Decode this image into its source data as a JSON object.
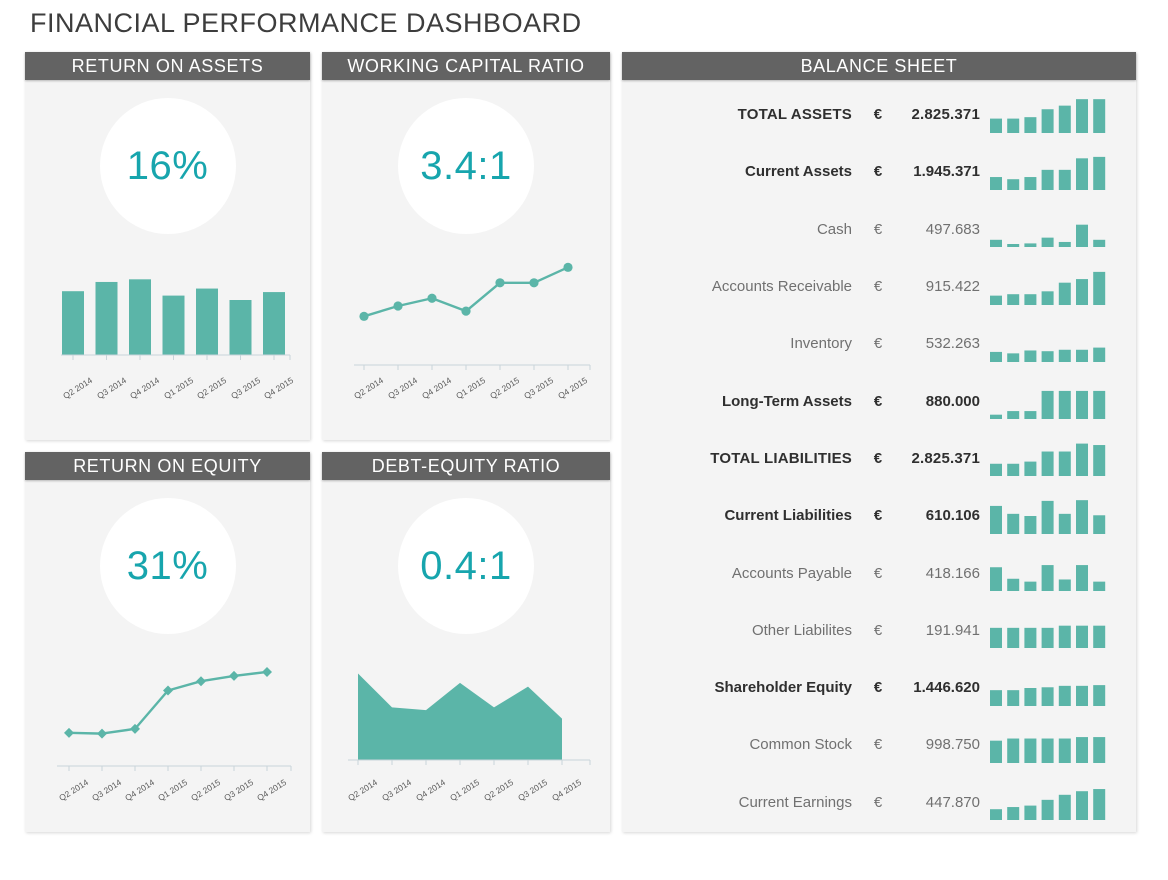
{
  "title": "FINANCIAL PERFORMANCE DASHBOARD",
  "colors": {
    "teal": "#5bb5a8",
    "kpi_text": "#17a5ad",
    "header_gray": "#636363",
    "panel_bg": "#f4f4f4",
    "title_text": "#3d3d3d"
  },
  "panels": {
    "roa": {
      "title": "RETURN ON ASSETS",
      "kpi": "16%"
    },
    "wcr": {
      "title": "WORKING CAPITAL RATIO",
      "kpi": "3.4:1"
    },
    "roe": {
      "title": "RETURN ON EQUITY",
      "kpi": "31%"
    },
    "der": {
      "title": "DEBT-EQUITY RATIO",
      "kpi": "0.4:1"
    },
    "balance": {
      "title": "BALANCE SHEET"
    }
  },
  "chart_data": [
    {
      "id": "roa",
      "type": "bar",
      "title": "RETURN ON ASSETS",
      "categories": [
        "Q2 2014",
        "Q3 2014",
        "Q4 2014",
        "Q1 2015",
        "Q2 2015",
        "Q3 2015",
        "Q4 2015"
      ],
      "values": [
        14.5,
        16.6,
        17.2,
        13.5,
        15.1,
        12.5,
        14.3
      ],
      "ylabel": "",
      "xlabel": "",
      "ylim": [
        0,
        20
      ],
      "grid": false,
      "legend": false
    },
    {
      "id": "wcr",
      "type": "line",
      "title": "WORKING CAPITAL RATIO",
      "categories": [
        "Q2 2014",
        "Q3 2014",
        "Q4 2014",
        "Q1 2015",
        "Q2 2015",
        "Q3 2015",
        "Q4 2015"
      ],
      "values": [
        1.5,
        1.9,
        2.2,
        1.7,
        2.8,
        2.8,
        3.4
      ],
      "marker": "circle",
      "ylabel": "",
      "xlabel": "",
      "ylim": [
        0,
        3.8
      ],
      "grid": false,
      "legend": false
    },
    {
      "id": "roe",
      "type": "line",
      "title": "RETURN ON EQUITY",
      "categories": [
        "Q2 2014",
        "Q3 2014",
        "Q4 2014",
        "Q1 2015",
        "Q2 2015",
        "Q3 2015",
        "Q4 2015"
      ],
      "values": [
        8,
        7.7,
        9.5,
        24,
        27.5,
        29.5,
        31
      ],
      "marker": "diamond",
      "ylabel": "",
      "xlabel": "",
      "ylim": [
        0,
        34
      ],
      "grid": false,
      "legend": false
    },
    {
      "id": "der",
      "type": "area",
      "title": "DEBT-EQUITY RATIO",
      "categories": [
        "Q2 2014",
        "Q3 2014",
        "Q4 2014",
        "Q1 2015",
        "Q2 2015",
        "Q3 2015",
        "Q4 2015"
      ],
      "values": [
        0.92,
        0.56,
        0.53,
        0.82,
        0.56,
        0.78,
        0.44
      ],
      "ylabel": "",
      "xlabel": "",
      "ylim": [
        0,
        1.0
      ],
      "grid": false,
      "legend": false
    }
  ],
  "balance_sheet": {
    "currency": "€",
    "sparkline_periods": [
      "Q2 2014",
      "Q3 2014",
      "Q4 2014",
      "Q1 2015",
      "Q2 2015",
      "Q3 2015",
      "Q4 2015"
    ],
    "rows": [
      {
        "label": "TOTAL ASSETS",
        "level": 0,
        "currency": "€",
        "value": "2.825.371",
        "spark": [
          0.4,
          0.4,
          0.44,
          0.66,
          0.76,
          0.94,
          0.94
        ]
      },
      {
        "label": "Current Assets",
        "level": 1,
        "currency": "€",
        "value": "1.945.371",
        "spark": [
          0.36,
          0.3,
          0.36,
          0.56,
          0.56,
          0.88,
          0.92
        ]
      },
      {
        "label": "Cash",
        "level": 2,
        "currency": "€",
        "value": "497.683",
        "spark": [
          0.2,
          0.08,
          0.1,
          0.26,
          0.14,
          0.62,
          0.2
        ]
      },
      {
        "label": "Accounts Receivable",
        "level": 2,
        "currency": "€",
        "value": "915.422",
        "spark": [
          0.26,
          0.3,
          0.3,
          0.38,
          0.62,
          0.72,
          0.92
        ]
      },
      {
        "label": "Inventory",
        "level": 2,
        "currency": "€",
        "value": "532.263",
        "spark": [
          0.28,
          0.24,
          0.32,
          0.3,
          0.34,
          0.34,
          0.4
        ]
      },
      {
        "label": "Long-Term Assets",
        "level": 1,
        "currency": "€",
        "value": "880.000",
        "spark": [
          0.12,
          0.22,
          0.22,
          0.78,
          0.78,
          0.78,
          0.78
        ]
      },
      {
        "label": "TOTAL LIABILITIES",
        "level": 0,
        "currency": "€",
        "value": "2.825.371",
        "spark": [
          0.34,
          0.34,
          0.4,
          0.68,
          0.68,
          0.9,
          0.86
        ]
      },
      {
        "label": "Current Liabilities",
        "level": 1,
        "currency": "€",
        "value": "610.106",
        "spark": [
          0.78,
          0.56,
          0.5,
          0.92,
          0.56,
          0.94,
          0.52
        ]
      },
      {
        "label": "Accounts Payable",
        "level": 2,
        "currency": "€",
        "value": "418.166",
        "spark": [
          0.66,
          0.34,
          0.26,
          0.72,
          0.32,
          0.72,
          0.26
        ]
      },
      {
        "label": "Other Liabilites",
        "level": 2,
        "currency": "€",
        "value": "191.941",
        "spark": [
          0.56,
          0.56,
          0.56,
          0.56,
          0.62,
          0.62,
          0.62
        ]
      },
      {
        "label": "Shareholder Equity",
        "level": 1,
        "currency": "€",
        "value": "1.446.620",
        "spark": [
          0.44,
          0.44,
          0.5,
          0.52,
          0.56,
          0.56,
          0.58
        ]
      },
      {
        "label": "Common Stock",
        "level": 2,
        "currency": "€",
        "value": "998.750",
        "spark": [
          0.62,
          0.68,
          0.68,
          0.68,
          0.68,
          0.72,
          0.72
        ]
      },
      {
        "label": "Current Earnings",
        "level": 2,
        "currency": "€",
        "value": "447.870",
        "spark": [
          0.3,
          0.36,
          0.4,
          0.56,
          0.7,
          0.8,
          0.86
        ]
      }
    ]
  }
}
